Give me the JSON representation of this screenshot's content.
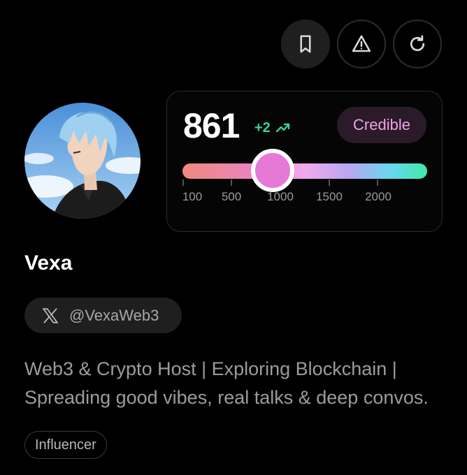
{
  "actions": [
    {
      "name": "bookmark",
      "icon": "bookmark-icon"
    },
    {
      "name": "report",
      "icon": "warning-icon"
    },
    {
      "name": "refresh",
      "icon": "refresh-icon"
    }
  ],
  "score": {
    "value": "861",
    "delta": "+2",
    "delta_color": "#35d399",
    "badge": "Credible",
    "badge_color": "#f0a4e6",
    "slider_value": 861,
    "ticks": [
      "100",
      "500",
      "1000",
      "1500",
      "2000"
    ]
  },
  "profile": {
    "name": "Vexa",
    "handle": "@VexaWeb3",
    "bio_lines": [
      "Web3 & Crypto Host | Exploring Blockchain |",
      "Spreading good vibes, real talks & deep convos."
    ],
    "tag": "Influencer"
  }
}
